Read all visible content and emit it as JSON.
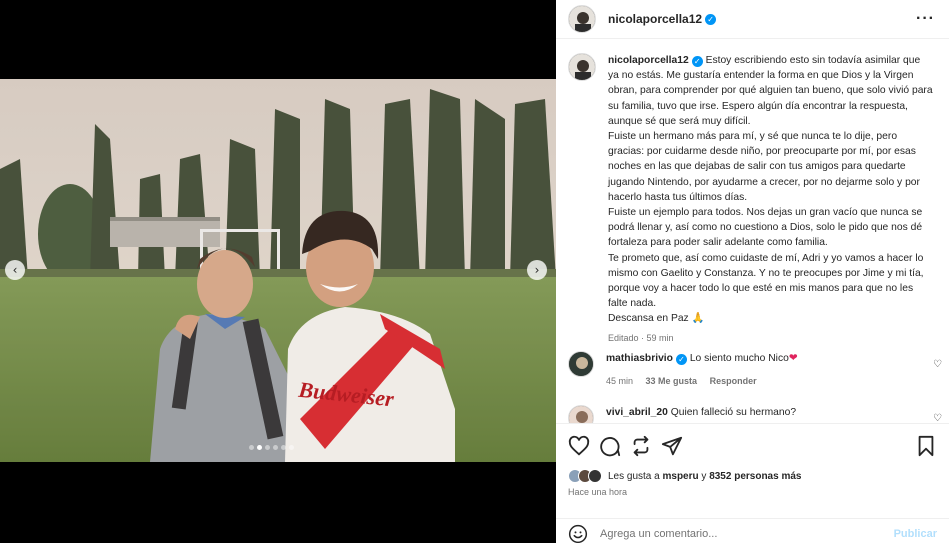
{
  "post": {
    "username": "nicolaporcella12",
    "verified": true
  },
  "carousel": {
    "prev_icon": "chevron-left-icon",
    "next_icon": "chevron-right-icon",
    "slide_count": 6,
    "active_slide": 2
  },
  "photo": {
    "jersey_text": "Budweiser"
  },
  "caption": {
    "username": "nicolaporcella12",
    "paragraphs": [
      "Estoy escribiendo esto sin todavía asimilar que ya no estás. Me gustaría entender la forma en que Dios y la Virgen obran, para comprender por qué alguien tan bueno, que solo vivió para su familia, tuvo que irse. Espero algún día encontrar la respuesta, aunque sé que será muy difícil.",
      "Fuiste un hermano más para mí, y sé que nunca te lo dije, pero gracias: por cuidarme desde niño, por preocuparte por mí, por esas noches en las que dejabas de salir con tus amigos para quedarte jugando Nintendo, por ayudarme a crecer, por no dejarme solo y por hacerlo hasta tus últimos días.",
      "Fuiste un ejemplo para todos. Nos dejas un gran vacío que nunca se podrá llenar y, así como no cuestiono a Dios, solo le pido que nos dé fortaleza para poder salir adelante como familia.",
      "Te prometo que, así como cuidaste de mí, Adri y yo vamos a hacer lo mismo con Gaelito y Constanza. Y no te preocupes por Jime y mi tía, porque voy a hacer todo lo que esté en mis manos para que no les falte nada.",
      "Descansa en Paz 🙏"
    ],
    "meta": "Editado · 59 min"
  },
  "comments": [
    {
      "username": "mathiasbrivio",
      "verified": true,
      "text": "Lo siento mucho Nico",
      "emoji": "❤",
      "time": "45 min",
      "likes": "33 Me gusta",
      "reply": "Responder"
    },
    {
      "username": "vivi_abril_20",
      "verified": false,
      "text": "Quien falleció su hermano?"
    }
  ],
  "likes_summary": {
    "prefix": "Les gusta a",
    "user": "msperu",
    "connector": "y",
    "others": "8352 personas más"
  },
  "timestamp": "Hace una hora",
  "composer": {
    "placeholder": "Agrega un comentario...",
    "publish_label": "Publicar"
  }
}
